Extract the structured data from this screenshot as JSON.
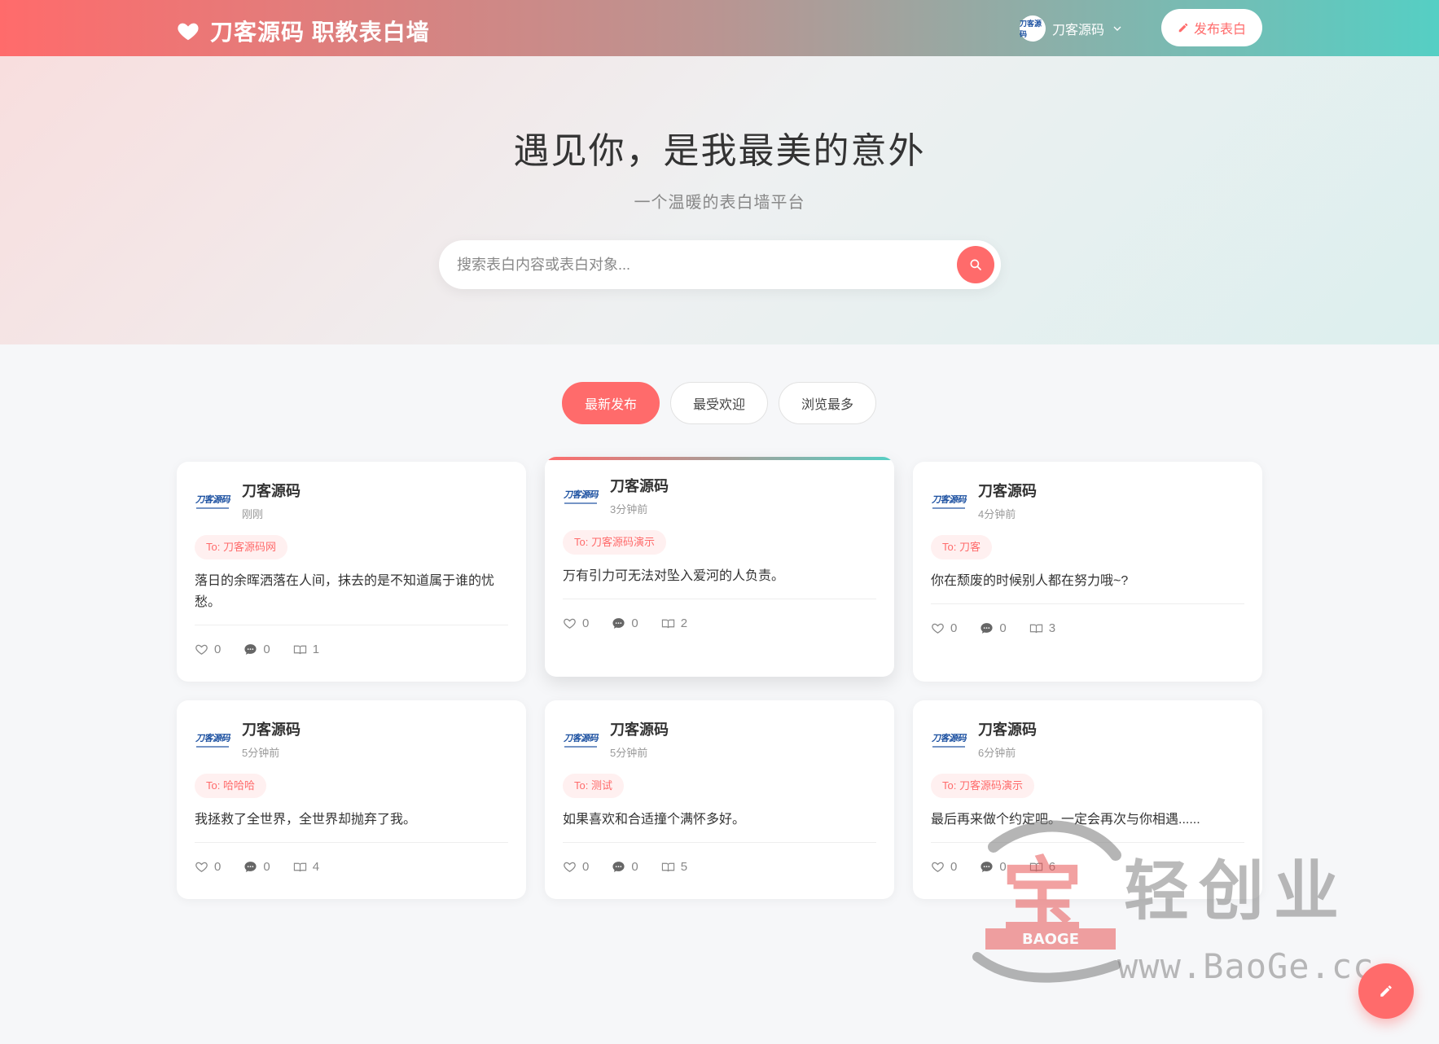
{
  "header": {
    "brand_title": "刀客源码 职教表白墙",
    "user_name": "刀客源码",
    "publish_label": "发布表白"
  },
  "hero": {
    "title": "遇见你，是我最美的意外",
    "subtitle": "一个温暖的表白墙平台",
    "search_placeholder": "搜索表白内容或表白对象..."
  },
  "tabs": [
    {
      "label": "最新发布",
      "active": true
    },
    {
      "label": "最受欢迎",
      "active": false
    },
    {
      "label": "浏览最多",
      "active": false
    }
  ],
  "logo_text": "刀客源码",
  "cards": [
    {
      "author": "刀客源码",
      "time": "刚刚",
      "to": "To: 刀客源码网",
      "content": "落日的余晖洒落在人间，抹去的是不知道属于谁的忧愁。",
      "likes": "0",
      "comments": "0",
      "views": "1"
    },
    {
      "author": "刀客源码",
      "time": "3分钟前",
      "to": "To: 刀客源码演示",
      "content": "万有引力可无法对坠入爱河的人负责。",
      "likes": "0",
      "comments": "0",
      "views": "2"
    },
    {
      "author": "刀客源码",
      "time": "4分钟前",
      "to": "To: 刀客",
      "content": "你在颓废的时候别人都在努力哦~?",
      "likes": "0",
      "comments": "0",
      "views": "3"
    },
    {
      "author": "刀客源码",
      "time": "5分钟前",
      "to": "To: 哈哈哈",
      "content": "我拯救了全世界，全世界却抛弃了我。",
      "likes": "0",
      "comments": "0",
      "views": "4"
    },
    {
      "author": "刀客源码",
      "time": "5分钟前",
      "to": "To: 测试",
      "content": "如果喜欢和合适撞个满怀多好。",
      "likes": "0",
      "comments": "0",
      "views": "5"
    },
    {
      "author": "刀客源码",
      "time": "6分钟前",
      "to": "To: 刀客源码演示",
      "content": "最后再来做个约定吧。一定会再次与你相遇......",
      "likes": "0",
      "comments": "0",
      "views": "6"
    }
  ],
  "watermark": {
    "logo_text": "BAOGE",
    "text": "轻创业",
    "url": "www.BaoGe.cc"
  },
  "colors": {
    "accent": "#ff6b6b",
    "teal": "#55cfc4",
    "tag_bg": "#fff0f0"
  },
  "icons": {
    "brand": "heart-icon",
    "publish": "pencil-icon",
    "search": "search-icon",
    "like": "heart-outline-icon",
    "comment": "comment-icon",
    "views": "book-icon",
    "fab": "pencil-icon"
  }
}
